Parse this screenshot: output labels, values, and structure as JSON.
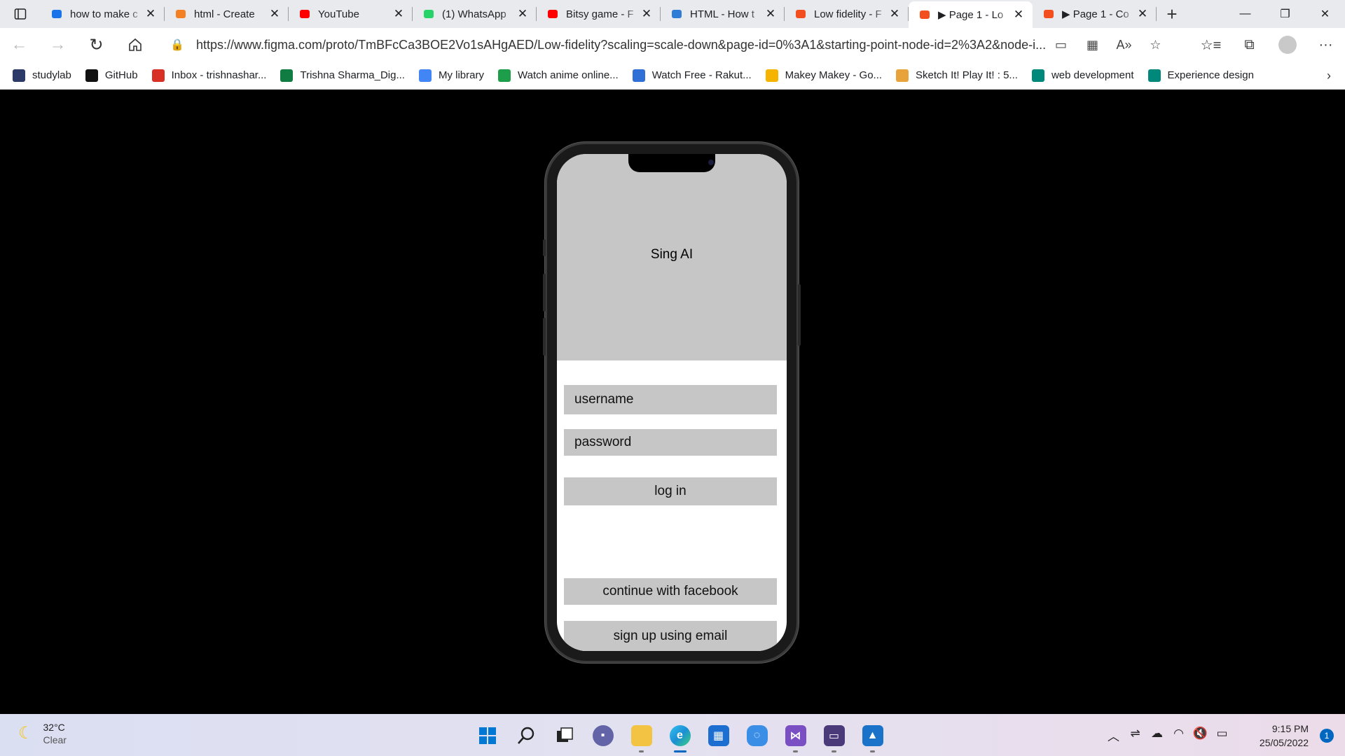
{
  "browser": {
    "tabs": [
      {
        "title": "how to make c",
        "icon": "search-icon",
        "color": "#1a73e8"
      },
      {
        "title": "html - Create",
        "icon": "stackoverflow-icon",
        "color": "#f48024"
      },
      {
        "title": "YouTube",
        "icon": "youtube-icon",
        "color": "#ff0000"
      },
      {
        "title": "(1) WhatsApp",
        "icon": "whatsapp-icon",
        "color": "#25d366"
      },
      {
        "title": "Bitsy game - F",
        "icon": "youtube-icon",
        "color": "#ff0000"
      },
      {
        "title": "HTML - How t",
        "icon": "bing-icon",
        "color": "#2f7cd6"
      },
      {
        "title": "Low fidelity - F",
        "icon": "figma-icon",
        "color": "#f24e1e"
      },
      {
        "title": "▶ Page 1 - Lo",
        "icon": "figma-icon",
        "color": "#f24e1e",
        "active": true
      },
      {
        "title": "▶ Page 1 - Co",
        "icon": "figma-icon",
        "color": "#f24e1e"
      }
    ],
    "url": "https://www.figma.com/proto/TmBFcCa3BOE2Vo1sAHgAED/Low-fidelity?scaling=scale-down&page-id=0%3A1&starting-point-node-id=2%3A2&node-i...",
    "bookmarks": [
      {
        "label": "studylab",
        "icon": "studylab-icon",
        "color": "#2b3a67"
      },
      {
        "label": "GitHub",
        "icon": "github-icon",
        "color": "#111111"
      },
      {
        "label": "Inbox - trishnashar...",
        "icon": "gmail-icon",
        "color": "#d93025"
      },
      {
        "label": "Trishna Sharma_Dig...",
        "icon": "sway-icon",
        "color": "#107c41"
      },
      {
        "label": "My library",
        "icon": "google-icon",
        "color": "#4285f4"
      },
      {
        "label": "Watch anime online...",
        "icon": "shield-icon",
        "color": "#1e9e4a"
      },
      {
        "label": "Watch Free - Rakut...",
        "icon": "rakuten-icon",
        "color": "#2f6fd6"
      },
      {
        "label": "Makey Makey - Go...",
        "icon": "slides-icon",
        "color": "#f4b400"
      },
      {
        "label": "Sketch It! Play It! : 5...",
        "icon": "sketch-icon",
        "color": "#e8a33a"
      },
      {
        "label": "web development",
        "icon": "meet-icon",
        "color": "#00897b"
      },
      {
        "label": "Experience design",
        "icon": "meet-icon",
        "color": "#00897b"
      }
    ]
  },
  "app": {
    "title": "Sing AI",
    "username_placeholder": "username",
    "password_placeholder": "password",
    "login_label": "log in",
    "facebook_label": "continue with facebook",
    "signup_label": "sign up using email"
  },
  "taskbar": {
    "temperature": "32°C",
    "condition": "Clear",
    "time": "9:15 PM",
    "date": "25/05/2022",
    "notification_count": "1"
  }
}
